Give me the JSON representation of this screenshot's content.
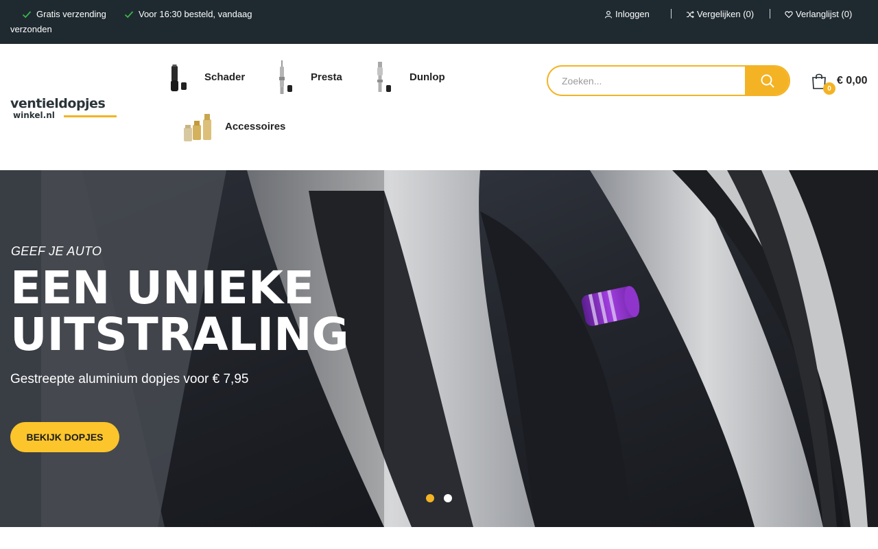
{
  "topbar": {
    "usps": [
      "Gratis verzending",
      "Voor 16:30 besteld, vandaag"
    ],
    "usp_wrap": "verzonden",
    "login": "Inloggen",
    "compare": "Vergelijken (0)",
    "wishlist": "Verlanglijst (0)"
  },
  "logo": {
    "main": "ventieldopjes",
    "sub": "winkel.nl"
  },
  "nav": {
    "items": [
      {
        "label": "Schader"
      },
      {
        "label": "Presta"
      },
      {
        "label": "Dunlop"
      },
      {
        "label": "Accessoires"
      }
    ]
  },
  "search": {
    "placeholder": "Zoeken..."
  },
  "cart": {
    "count": "0",
    "total": "€ 0,00"
  },
  "hero": {
    "eyebrow": "GEEF JE AUTO",
    "title_line1": "EEN UNIEKE",
    "title_line2": "UITSTRALING",
    "subtitle": "Gestreepte aluminium dopjes voor € 7,95",
    "button": "BEKIJK DOPJES",
    "slides_active": 1,
    "slides_total": 2
  },
  "colors": {
    "topbar": "#1f2a30",
    "accent": "#f4b324",
    "button": "#fcc52b",
    "check": "#3bb54a"
  },
  "icons": [
    "check-icon",
    "user-icon",
    "shuffle-icon",
    "heart-icon",
    "search-icon",
    "shopping-bag-icon"
  ]
}
